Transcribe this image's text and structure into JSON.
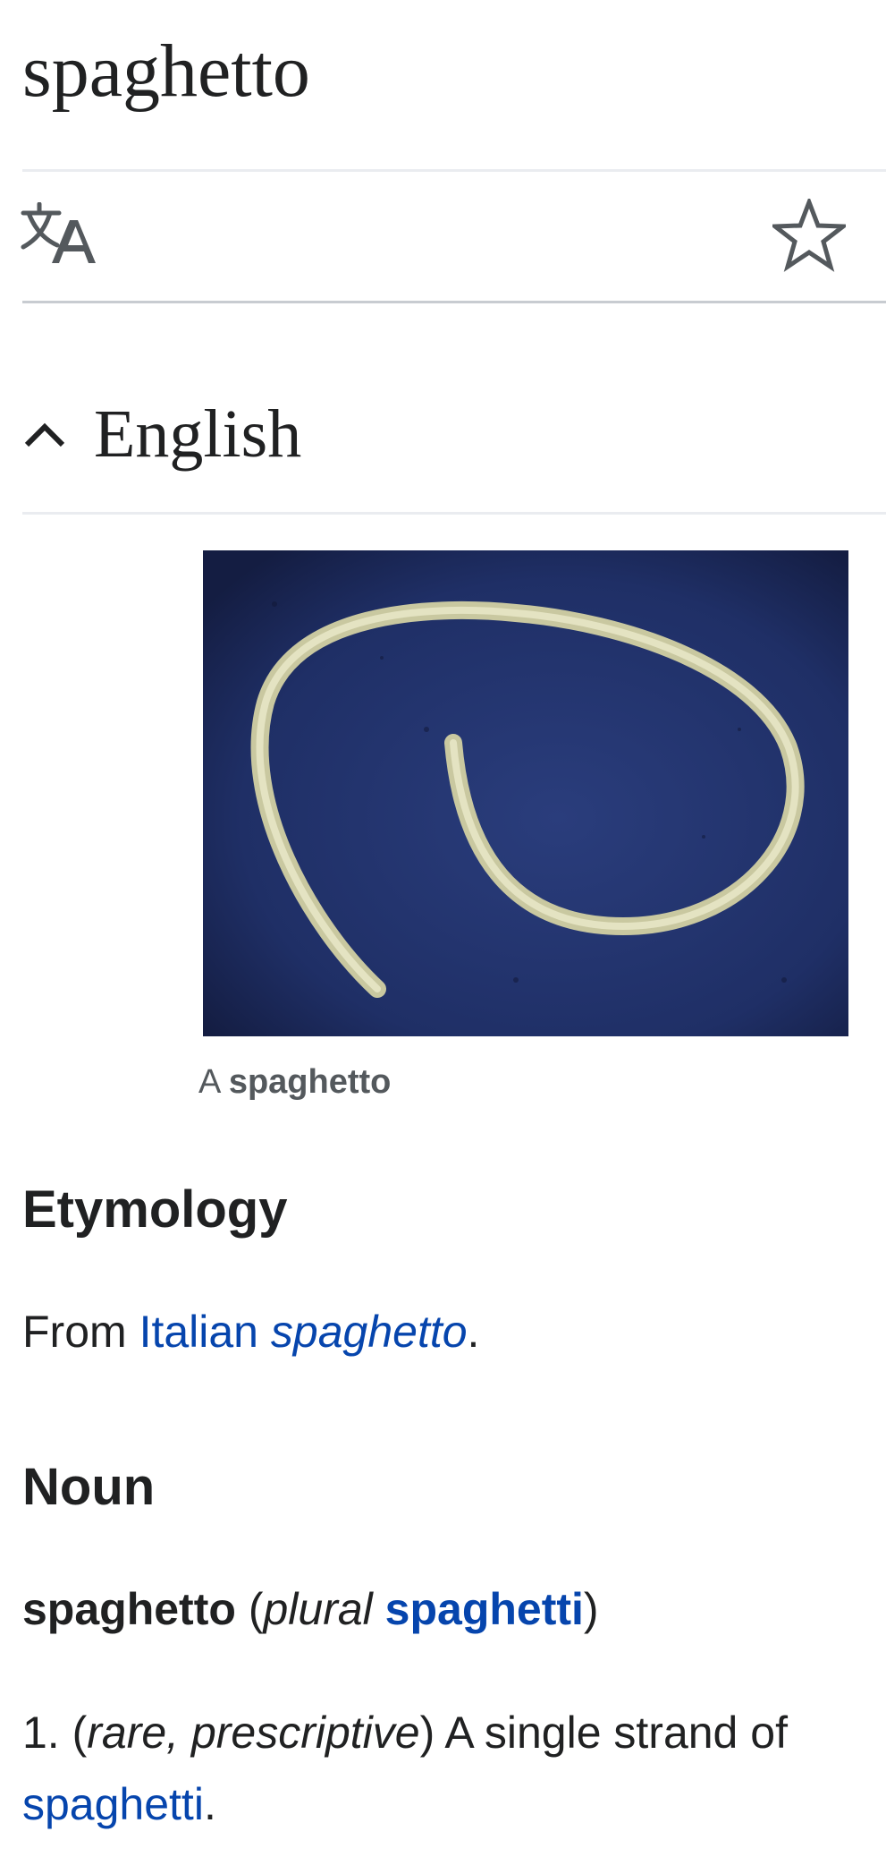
{
  "page": {
    "title": "spaghetto"
  },
  "toolbar": {
    "language_icon": "translate-icon",
    "watch_icon": "star-icon"
  },
  "section": {
    "title": "English",
    "toggle_icon": "chevron-up-icon"
  },
  "figure": {
    "caption_prefix": "A",
    "caption_term": "spaghetto"
  },
  "etymology": {
    "heading": "Etymology",
    "prefix": "From",
    "lang_link": "Italian",
    "term_link": "spaghetto",
    "suffix": "."
  },
  "noun": {
    "heading": "Noun",
    "headword": "spaghetto",
    "open_paren": "(",
    "plural_label": "plural",
    "plural_link": "spaghetti",
    "close_paren": ")"
  },
  "definitions": [
    {
      "number": "1.",
      "qualifier": "rare, prescriptive",
      "text": "A single strand of",
      "link": "spaghetti",
      "end": "."
    }
  ],
  "colors": {
    "link": "#0645ad",
    "text": "#202122",
    "muted": "#54595d",
    "rule": "#eaecf0"
  }
}
